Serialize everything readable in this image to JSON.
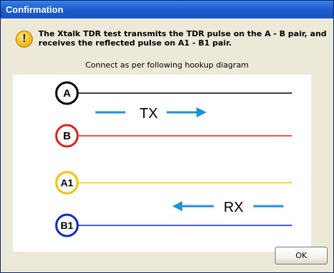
{
  "window": {
    "title": "Confirmation"
  },
  "message": {
    "icon": "warning-icon",
    "line1": "The Xtalk TDR test transmits the TDR pulse on the A - B pair, and",
    "line2": "receives the reflected pulse on A1 - B1 pair."
  },
  "instruction": "Connect as per following hookup diagram",
  "diagram": {
    "wires": [
      {
        "label": "A",
        "color": "#000000"
      },
      {
        "label": "B",
        "color": "#e02020"
      },
      {
        "label": "A1",
        "color": "#f5c400"
      },
      {
        "label": "B1",
        "color": "#1028c8"
      }
    ],
    "tx_label": "TX",
    "rx_label": "RX",
    "arrow_color": "#1e90e0"
  },
  "buttons": {
    "ok_label": "OK"
  }
}
